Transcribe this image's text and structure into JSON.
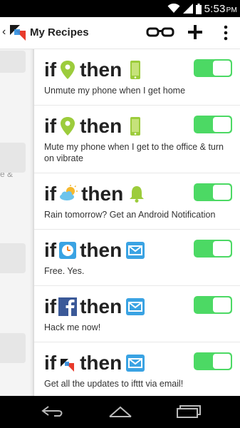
{
  "status_bar": {
    "time": "5:53",
    "ampm": "PM"
  },
  "action_bar": {
    "back": "‹",
    "title": "My Recipes"
  },
  "left_panel": {
    "partial_text": "e &"
  },
  "recipes": [
    {
      "if": "if",
      "then": "then",
      "trigger": "location-pin-icon",
      "action": "android-phone-icon",
      "description": "Unmute my phone when I get home",
      "enabled": true
    },
    {
      "if": "if",
      "then": "then",
      "trigger": "location-pin-icon",
      "action": "android-phone-icon",
      "description": "Mute my phone when I get to the office & turn on vibrate",
      "enabled": true
    },
    {
      "if": "if",
      "then": "then",
      "trigger": "weather-icon",
      "action": "android-notification-icon",
      "description": "Rain tomorrow? Get an Android Notification",
      "enabled": true
    },
    {
      "if": "if",
      "then": "then",
      "trigger": "clock-icon",
      "action": "email-icon",
      "description": "Free. Yes.",
      "enabled": true
    },
    {
      "if": "if",
      "then": "then",
      "trigger": "facebook-icon",
      "action": "email-icon",
      "description": "Hack me now!",
      "enabled": true
    },
    {
      "if": "if",
      "then": "then",
      "trigger": "ifttt-logo-icon",
      "action": "email-icon",
      "description": "Get all the updates to ifttt via email!",
      "enabled": true
    }
  ],
  "colors": {
    "toggle_on": "#4cd964",
    "android_green": "#9ccc3c",
    "email_blue": "#3aa3e3",
    "facebook_blue": "#3b5998"
  }
}
